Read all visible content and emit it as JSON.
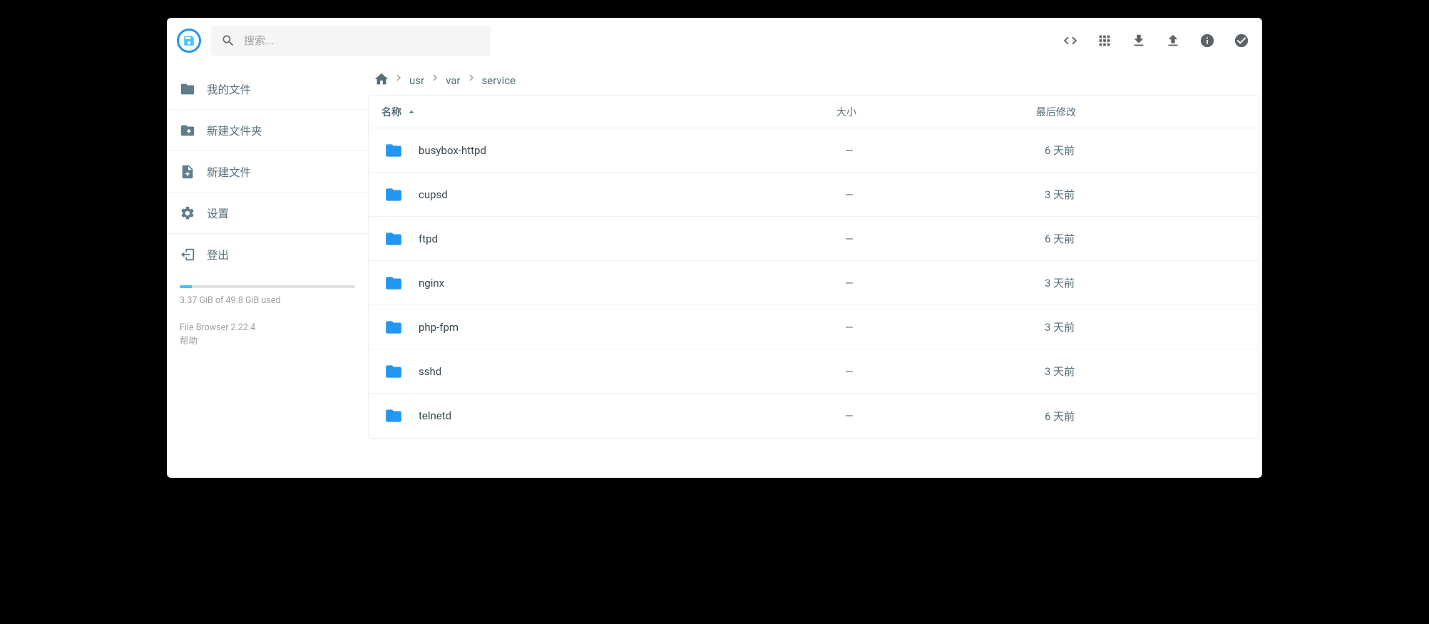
{
  "search": {
    "placeholder": "搜索..."
  },
  "sidebar": {
    "items": [
      {
        "label": "我的文件"
      },
      {
        "label": "新建文件夹"
      },
      {
        "label": "新建文件"
      },
      {
        "label": "设置"
      },
      {
        "label": "登出"
      }
    ],
    "storage": {
      "percent": 6.8,
      "text": "3.37 GiB of 49.8 GiB used"
    },
    "version": "File Browser 2.22.4",
    "help": "帮助"
  },
  "breadcrumbs": [
    "usr",
    "var",
    "service"
  ],
  "columns": {
    "name": "名称",
    "size": "大小",
    "modified": "最后修改"
  },
  "rows": [
    {
      "name": "busybox-httpd",
      "size": "—",
      "modified": "6 天前"
    },
    {
      "name": "cupsd",
      "size": "—",
      "modified": "3 天前"
    },
    {
      "name": "ftpd",
      "size": "—",
      "modified": "6 天前"
    },
    {
      "name": "nginx",
      "size": "—",
      "modified": "3 天前"
    },
    {
      "name": "php-fpm",
      "size": "—",
      "modified": "3 天前"
    },
    {
      "name": "sshd",
      "size": "—",
      "modified": "3 天前"
    },
    {
      "name": "telnetd",
      "size": "—",
      "modified": "6 天前"
    }
  ]
}
